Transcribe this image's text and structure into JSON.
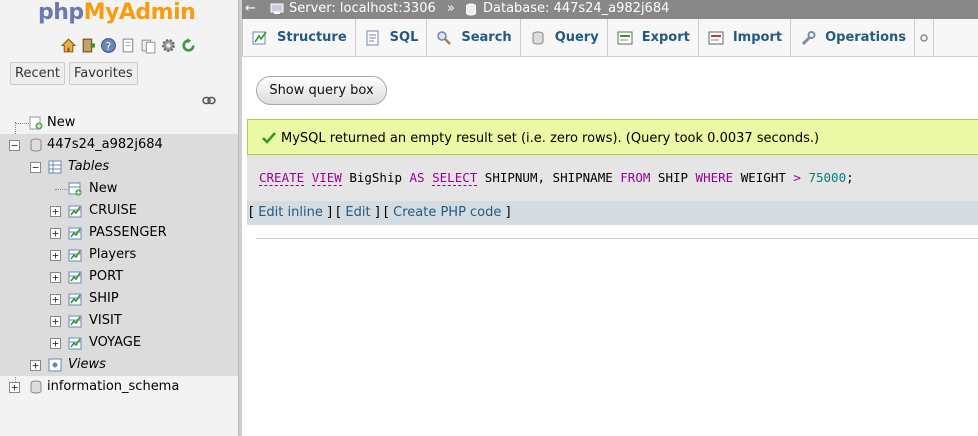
{
  "app": {
    "logo_php": "php",
    "logo_my": "My",
    "logo_admin": "Admin"
  },
  "nav": {
    "tabs": [
      "Recent",
      "Favorites"
    ],
    "tree": {
      "new_label": "New",
      "database": "447s24_a982j684",
      "tables_label": "Tables",
      "tables_new_label": "New",
      "tables": [
        "CRUISE",
        "PASSENGER",
        "Players",
        "PORT",
        "SHIP",
        "VISIT",
        "VOYAGE"
      ],
      "views_label": "Views",
      "other_db": "information_schema"
    }
  },
  "breadcrumb": {
    "server": "Server: localhost:3306",
    "separator": "»",
    "database": "Database: 447s24_a982j684"
  },
  "menu": {
    "tabs": [
      "Structure",
      "SQL",
      "Search",
      "Query",
      "Export",
      "Import",
      "Operations"
    ]
  },
  "main": {
    "show_query_label": "Show query box",
    "success_message": "MySQL returned an empty result set (i.e. zero rows). (Query took 0.0037 seconds.)",
    "sql": {
      "t1": "CREATE",
      "t2": "VIEW",
      "t3": " BigShip ",
      "t4": "AS",
      "t5": " ",
      "t6": "SELECT",
      "t7": " SHIPNUM, SHIPNAME ",
      "t8": "FROM",
      "t9": " SHIP ",
      "t10": "WHERE",
      "t11": " WEIGHT ",
      "t12": ">",
      "t13": " ",
      "t14": "75000",
      "t15": ";"
    },
    "actions": {
      "open1": "[ ",
      "edit_inline": "Edit inline",
      "mid1": " ] [ ",
      "edit": "Edit",
      "mid2": " ] [ ",
      "create_php": "Create PHP code",
      "close": " ]"
    }
  },
  "colors": {
    "link": "#235a81",
    "success_bg": "#ebf8a4",
    "topbar": "#888888",
    "keyword": "#990099",
    "number": "#008080"
  }
}
